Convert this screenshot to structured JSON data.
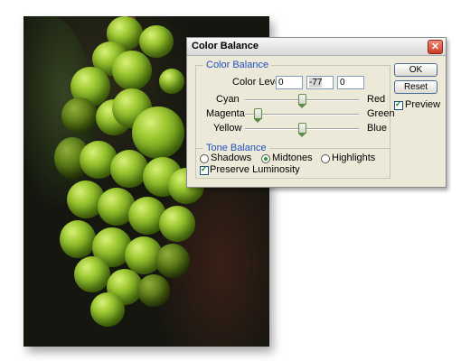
{
  "dialog": {
    "title": "Color Balance",
    "close_glyph": "✕",
    "color_balance": {
      "legend": "Color Balance",
      "levels_label": "Color Levels:",
      "levels": [
        "0",
        "-77",
        "0"
      ],
      "sliders": [
        {
          "left": "Cyan",
          "right": "Red",
          "value": 0
        },
        {
          "left": "Magenta",
          "right": "Green",
          "value": -77
        },
        {
          "left": "Yellow",
          "right": "Blue",
          "value": 0
        }
      ],
      "slider_range": [
        -100,
        100
      ]
    },
    "tone_balance": {
      "legend": "Tone Balance",
      "options": [
        "Shadows",
        "Midtones",
        "Highlights"
      ],
      "selected": "Midtones",
      "preserve_luminosity_label": "Preserve Luminosity",
      "preserve_luminosity_checked": true
    },
    "buttons": {
      "ok": "OK",
      "reset": "Reset"
    },
    "preview_label": "Preview",
    "preview_checked": true
  },
  "icons": {
    "close": "close-icon"
  },
  "colors": {
    "legend_blue": "#1f4fbf",
    "dialog_bg": "#ece9d8",
    "close_red": "#cc3a22"
  }
}
